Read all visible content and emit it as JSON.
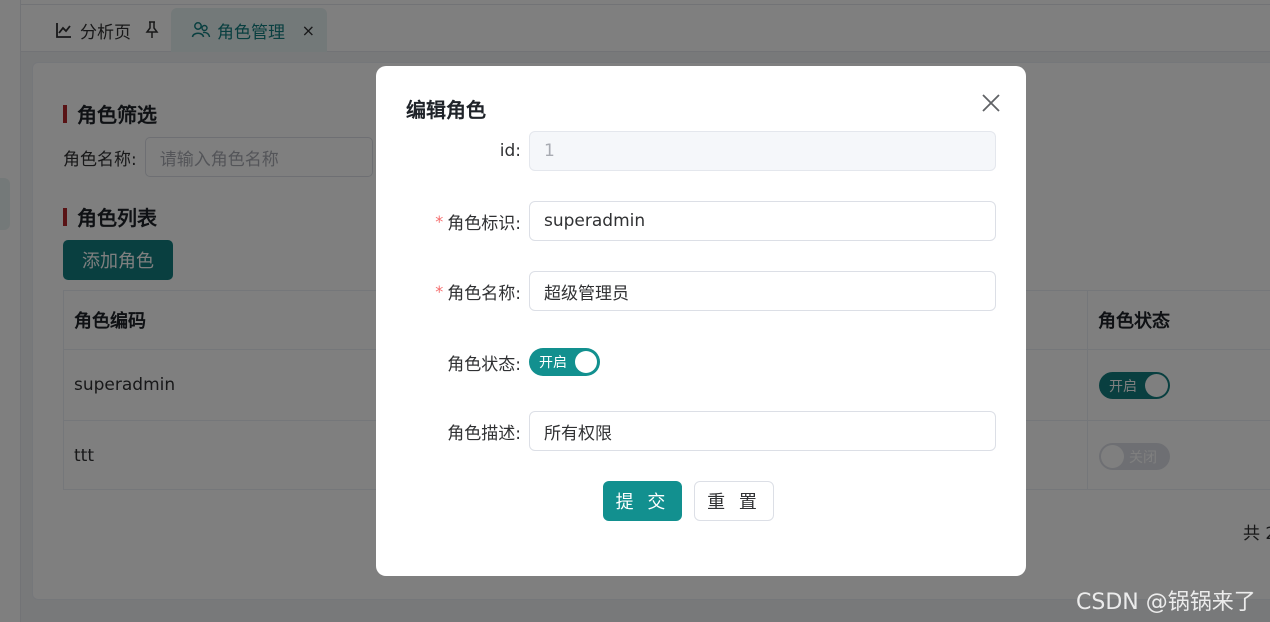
{
  "tabs": [
    {
      "label": "分析页",
      "icon": "chart-line-icon",
      "pinned": true
    },
    {
      "label": "角色管理",
      "icon": "user-group-icon",
      "active": true,
      "close": "×"
    }
  ],
  "filter": {
    "title": "角色筛选",
    "name_label": "角色名称:",
    "name_placeholder": "请输入角色名称"
  },
  "list": {
    "title": "角色列表",
    "add_button": "添加角色",
    "columns": {
      "code": "角色编码",
      "status": "角色状态"
    },
    "rows": [
      {
        "code": "superadmin",
        "status_text": "开启",
        "status_on": true
      },
      {
        "code": "ttt",
        "status_text": "关闭",
        "status_on": false
      }
    ],
    "total_text": "共 2"
  },
  "dialog": {
    "title": "编辑角色",
    "fields": {
      "id": {
        "label": "id:",
        "value": "1",
        "disabled": true
      },
      "role_key": {
        "label": "角色标识:",
        "value": "superadmin",
        "required": true
      },
      "role_name": {
        "label": "角色名称:",
        "value": "超级管理员",
        "required": true
      },
      "role_status": {
        "label": "角色状态:",
        "switch_text": "开启",
        "on": true
      },
      "role_desc": {
        "label": "角色描述:",
        "value": "所有权限"
      }
    },
    "submit_label": "提 交",
    "reset_label": "重 置"
  },
  "colors": {
    "primary": "#127f80",
    "switch_on": "#12908f",
    "required": "#f56c6c",
    "accent_bar": "#b3262b"
  },
  "watermark": "CSDN @锅锅来了"
}
